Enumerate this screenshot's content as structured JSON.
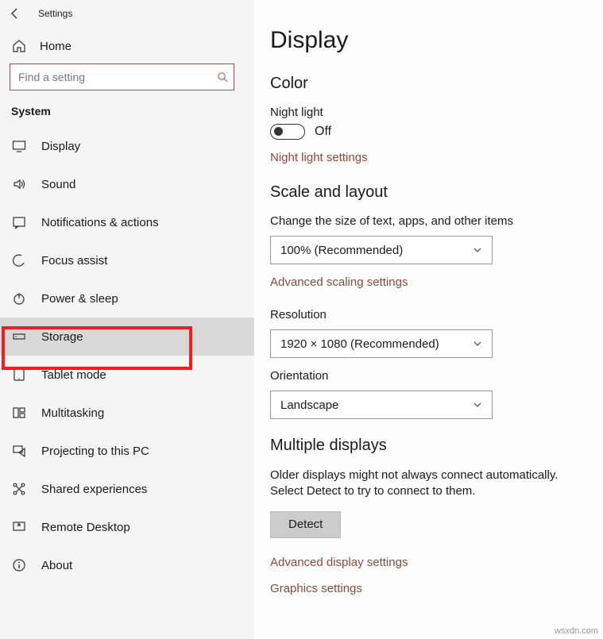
{
  "header": {
    "title": "Settings"
  },
  "sidebar": {
    "home_label": "Home",
    "search_placeholder": "Find a setting",
    "section_label": "System",
    "items": [
      {
        "label": "Display"
      },
      {
        "label": "Sound"
      },
      {
        "label": "Notifications & actions"
      },
      {
        "label": "Focus assist"
      },
      {
        "label": "Power & sleep"
      },
      {
        "label": "Storage"
      },
      {
        "label": "Tablet mode"
      },
      {
        "label": "Multitasking"
      },
      {
        "label": "Projecting to this PC"
      },
      {
        "label": "Shared experiences"
      },
      {
        "label": "Remote Desktop"
      },
      {
        "label": "About"
      }
    ]
  },
  "main": {
    "page_title": "Display",
    "color": {
      "heading": "Color",
      "night_light_label": "Night light",
      "night_light_state": "Off",
      "night_light_link": "Night light settings"
    },
    "scale": {
      "heading": "Scale and layout",
      "size_label": "Change the size of text, apps, and other items",
      "size_value": "100% (Recommended)",
      "advanced_link": "Advanced scaling settings",
      "resolution_label": "Resolution",
      "resolution_value": "1920 × 1080 (Recommended)",
      "orientation_label": "Orientation",
      "orientation_value": "Landscape"
    },
    "multi": {
      "heading": "Multiple displays",
      "desc": "Older displays might not always connect automatically. Select Detect to try to connect to them.",
      "detect_label": "Detect",
      "adv_display_link": "Advanced display settings",
      "graphics_link": "Graphics settings"
    }
  },
  "watermark": "wsxdn.com"
}
